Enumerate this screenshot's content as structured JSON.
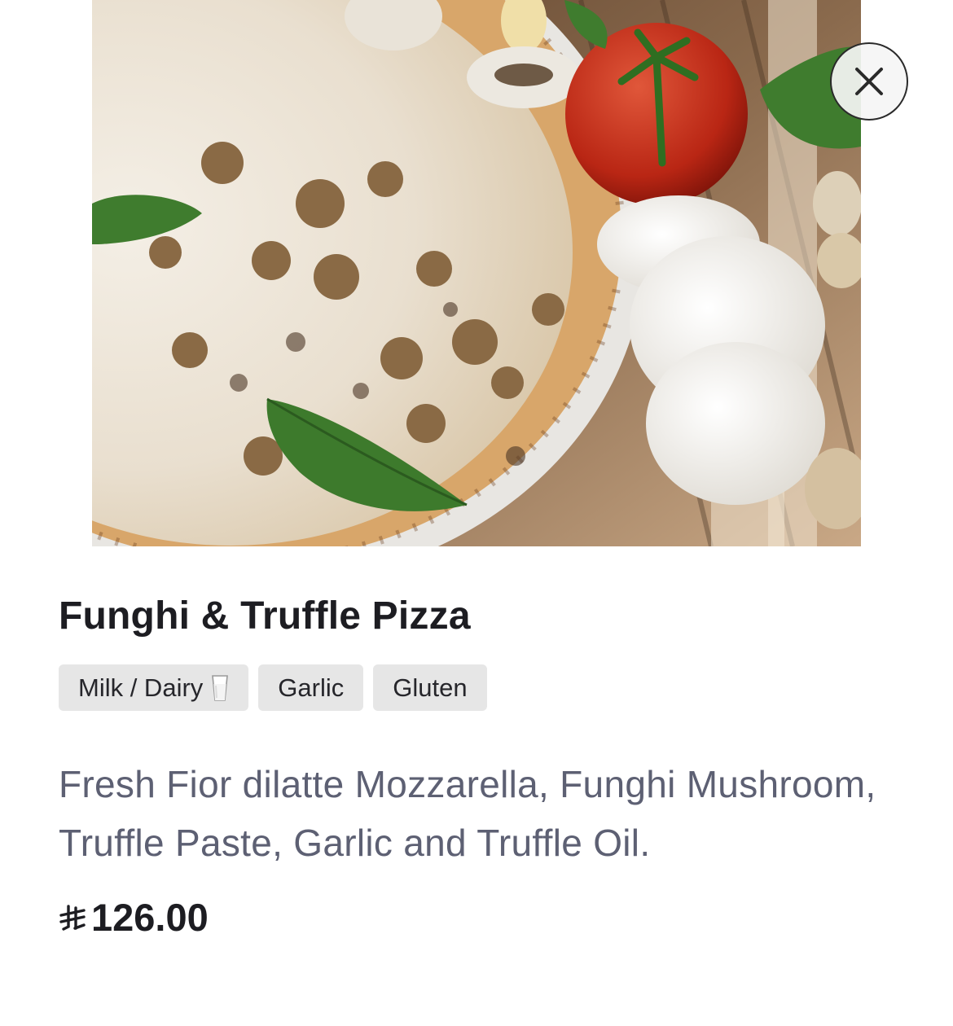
{
  "item": {
    "title": "Funghi & Truffle Pizza",
    "allergens": [
      {
        "label": "Milk / Dairy",
        "icon": "milk-glass-icon"
      },
      {
        "label": "Garlic"
      },
      {
        "label": "Gluten"
      }
    ],
    "description": "Fresh Fior dilatte Mozzarella, Funghi Mushroom, Truffle Paste, Garlic and Truffle Oil.",
    "price": "126.00",
    "currency_icon": "saudi-riyal-icon"
  },
  "controls": {
    "close_icon": "close-icon"
  },
  "colors": {
    "title": "#1d1d22",
    "description": "#5d6073",
    "tag_bg": "#e6e6e6"
  }
}
